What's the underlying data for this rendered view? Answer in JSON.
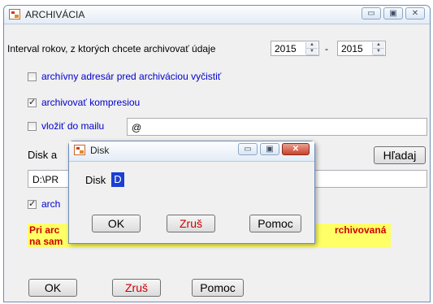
{
  "main_window": {
    "title": "ARCHIVÁCIA",
    "controls": {
      "minimize": "▭",
      "maximize": "▣",
      "close": "✕"
    },
    "interval_label": "Interval rokov, z ktorých chcete archivovať údaje",
    "year_from": "2015",
    "year_separator": "-",
    "year_to": "2015",
    "clear_dir_label": "archívny adresár pred archiváciou vyčistiť",
    "compress_label": "archivovať kompresiou",
    "email_label": "vložiť do mailu",
    "email_value": "@",
    "disk_label": "Disk a",
    "find_button": "Hľadaj",
    "path_value": "D:\\PR",
    "arch_checkbox_label": "arch",
    "warning_line1_left": "Pri arc",
    "warning_line1_right": "rchivovaná",
    "warning_line2_left": "na sam",
    "ok_button": "OK",
    "cancel_button": "Zruš",
    "help_button": "Pomoc"
  },
  "disk_dialog": {
    "title": "Disk",
    "controls": {
      "minimize": "▭",
      "maximize": "▣",
      "close": "✕"
    },
    "disk_label": "Disk",
    "disk_value": "D",
    "ok_button": "OK",
    "cancel_button": "Zruš",
    "help_button": "Pomoc"
  },
  "state": {
    "clear_dir_checked": false,
    "compress_checked": true,
    "email_checked": false,
    "arch_checked": true
  },
  "colors": {
    "link_blue": "#0000cc",
    "warning_red": "#cc0000",
    "warning_bg": "#ffff66",
    "disk_highlight": "#1a3fd1"
  }
}
